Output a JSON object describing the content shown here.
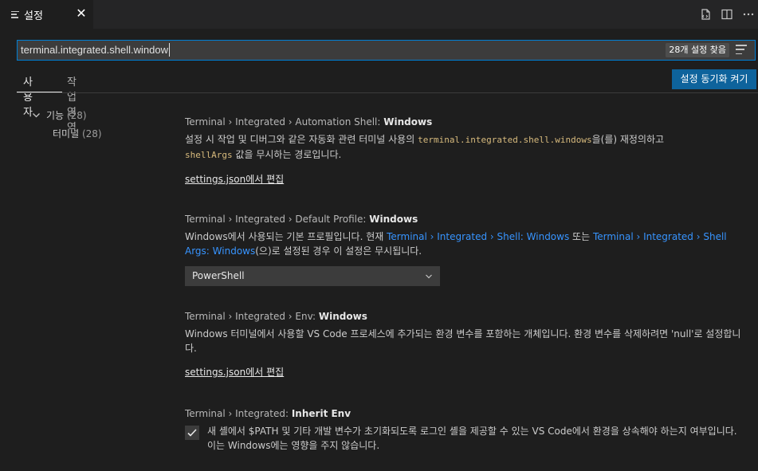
{
  "tab": {
    "label": "설정",
    "close": "✕"
  },
  "search": {
    "value": "terminal.integrated.shell.window",
    "result_count": "28개 설정 찾음"
  },
  "scopes": {
    "user": "사용자",
    "workspace": "작업 영역"
  },
  "sync_button": "설정 동기화 켜기",
  "toc": {
    "group_label": "기능",
    "group_count": "(28)",
    "item_label": "터미널",
    "item_count": "(28)"
  },
  "settings": [
    {
      "category": "Terminal › Integrated › Automation Shell: ",
      "key": "Windows",
      "desc_part1": "설정 시 작업 및 디버그와 같은 자동화 관련 터미널 사용의 ",
      "desc_code1": "terminal.integrated.shell.windows",
      "desc_part2": "을(를) 재정의하고 ",
      "desc_code2": "shellArgs",
      "desc_part3": " 값을 무시하는 경로입니다.",
      "edit_link": "settings.json에서 편집"
    },
    {
      "category": "Terminal › Integrated › Default Profile: ",
      "key": "Windows",
      "desc_part1": "Windows에서 사용되는 기본 프로필입니다. 현재 ",
      "link1": "Terminal › Integrated › Shell: Windows",
      "desc_part2": " 또는 ",
      "link2": "Terminal › Integrated › Shell Args: Windows",
      "desc_part3": "(으)로 설정된 경우 이 설정은 무시됩니다.",
      "select_value": "PowerShell"
    },
    {
      "category": "Terminal › Integrated › Env: ",
      "key": "Windows",
      "desc": "Windows 터미널에서 사용할 VS Code 프로세스에 추가되는 환경 변수를 포함하는 개체입니다. 환경 변수를 삭제하려면 'null'로 설정합니다.",
      "edit_link": "settings.json에서 편집"
    },
    {
      "category": "Terminal › Integrated: ",
      "key": "Inherit Env",
      "checked": true,
      "checkbox_label": "새 셸에서 $PATH 및 기타 개발 변수가 초기화되도록 로그인 셸을 제공할 수 있는 VS Code에서 환경을 상속해야 하는지 여부입니다. 이는 Windows에는 영향을 주지 않습니다."
    }
  ],
  "icons": {
    "tab": "settings-list-icon",
    "split_json": "open-json-icon",
    "split_editor": "split-editor-icon",
    "more": "more-actions-icon",
    "filter": "filter-icon",
    "chevron": "chevron-down-icon",
    "check": "check-icon"
  }
}
